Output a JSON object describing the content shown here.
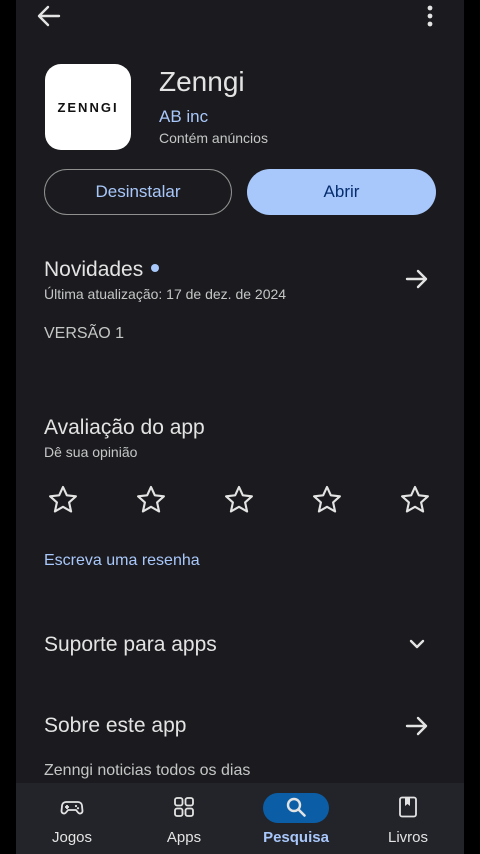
{
  "app": {
    "name": "Zenngi",
    "icon_text": "ZENNGI",
    "developer": "AB inc",
    "ads_notice": "Contém anúncios"
  },
  "actions": {
    "uninstall_label": "Desinstalar",
    "open_label": "Abrir"
  },
  "whats_new": {
    "title": "Novidades",
    "last_update": "Última atualização: 17 de dez. de 2024",
    "notes": "VERSÃO 1"
  },
  "rating": {
    "title": "Avaliação do app",
    "subtitle": "Dê sua opinião",
    "stars_total": 5,
    "stars_selected": 0,
    "write_review_label": "Escreva uma resenha"
  },
  "support": {
    "title": "Suporte para apps"
  },
  "about": {
    "title": "Sobre este app",
    "description": "Zenngi noticias todos os dias"
  },
  "bottom_nav": {
    "items": [
      {
        "label": "Jogos",
        "icon": "gamepad-icon"
      },
      {
        "label": "Apps",
        "icon": "apps-grid-icon"
      },
      {
        "label": "Pesquisa",
        "icon": "search-icon",
        "active": true
      },
      {
        "label": "Livros",
        "icon": "bookmark-book-icon"
      }
    ]
  },
  "colors": {
    "background": "#1b1b1f",
    "accent": "#a8c7fa",
    "accent_text": "#062e6f",
    "nav_active_pill": "#0b5ea6"
  }
}
